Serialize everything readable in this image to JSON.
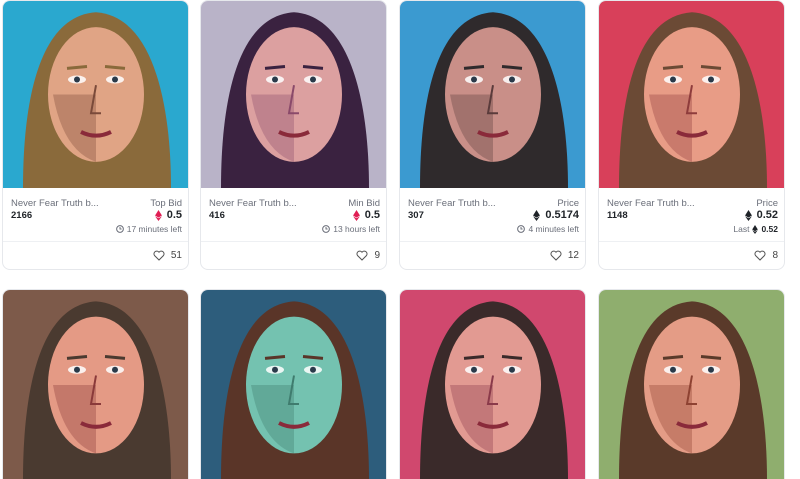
{
  "cards": [
    {
      "title": "Never Fear Truth b...",
      "token_id": "2166",
      "price_label": "Top Bid",
      "price": "0.5",
      "sub_value": "",
      "sub_text": "17 minutes left",
      "likes": "51",
      "colors": {
        "bg": "#2aa8cf",
        "skin": "#e0a485",
        "hair": "#8a6a3b",
        "shadow": "#7a4a3a"
      }
    },
    {
      "title": "Never Fear Truth b...",
      "token_id": "416",
      "price_label": "Min Bid",
      "price": "0.5",
      "sub_value": "",
      "sub_text": "13 hours left",
      "likes": "9",
      "colors": {
        "bg": "#b9b3c8",
        "skin": "#dca0a0",
        "hair": "#3a2240",
        "shadow": "#8a4a6a"
      }
    },
    {
      "title": "Never Fear Truth b...",
      "token_id": "307",
      "price_label": "Price",
      "price": "0.5174",
      "sub_value": "",
      "sub_text": "4 minutes left",
      "likes": "12",
      "colors": {
        "bg": "#3b9ad0",
        "skin": "#c98f88",
        "hair": "#2f2a2c",
        "shadow": "#5a3b3b"
      }
    },
    {
      "title": "Never Fear Truth b...",
      "token_id": "1148",
      "price_label": "Price",
      "price": "0.52",
      "sub_value": "0.52",
      "sub_text": "Last",
      "likes": "8",
      "colors": {
        "bg": "#d8405a",
        "skin": "#e89c86",
        "hair": "#6b4a35",
        "shadow": "#8e3c3c"
      }
    },
    {
      "colors": {
        "bg": "#7d5a4a",
        "skin": "#e49a85",
        "hair": "#4a3a30",
        "shadow": "#8a3a3a"
      }
    },
    {
      "colors": {
        "bg": "#2d5d7c",
        "skin": "#74c2b0",
        "hair": "#5a3528",
        "shadow": "#3f7c6e"
      }
    },
    {
      "colors": {
        "bg": "#d0486e",
        "skin": "#e29a92",
        "hair": "#3a2a2a",
        "shadow": "#8a3a4a"
      }
    },
    {
      "colors": {
        "bg": "#8fae6e",
        "skin": "#e49c86",
        "hair": "#5a3a2a",
        "shadow": "#8e4232"
      }
    }
  ],
  "colors": {
    "eth": "#e01e54",
    "text": "#1f2328",
    "muted": "#6b6f7a"
  }
}
